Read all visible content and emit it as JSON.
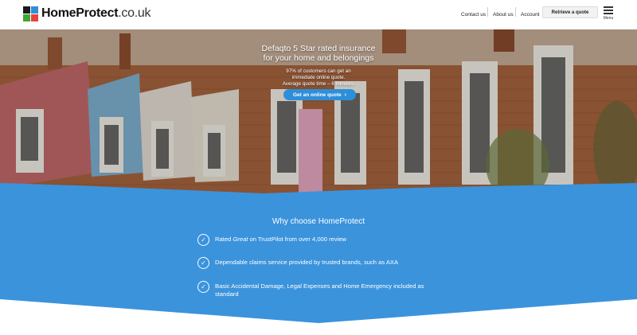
{
  "header": {
    "logo": {
      "word_main": "HomeProtect",
      "word_tld": ".co.uk",
      "grid_colors": [
        "#1a1a1a",
        "#2e8fd9",
        "#3fa535",
        "#e8423b"
      ]
    },
    "nav": {
      "contact": "Contact us",
      "about": "About us",
      "account": "Account",
      "retrieve": "Retrieve a quote",
      "menu": "Menu"
    }
  },
  "hero": {
    "title_line1": "Defaqto 5 Star rated insurance",
    "title_line2": "for your home and belongings",
    "sub_line1": "97% of customers can get an",
    "sub_line2": "immediate online quote.",
    "sub_line3": "Average quote time – 6 minutes.",
    "cta": "Get an online quote",
    "cta_icon": "chevron-right-icon"
  },
  "why": {
    "title": "Why choose HomeProtect",
    "items": [
      {
        "pre": "Rated ",
        "em": "Great",
        "post": " on TrustPilot from over 4,000 review"
      },
      {
        "text": "Dependable claims service provided by trusted brands, such as AXA"
      },
      {
        "text": "Basic Accidental Damage, Legal Expenses and Home Emergency included as standard"
      }
    ]
  },
  "colors": {
    "accent_blue": "#3b93dc",
    "button_blue": "#2e8fd9",
    "brick": "#a45a35"
  }
}
